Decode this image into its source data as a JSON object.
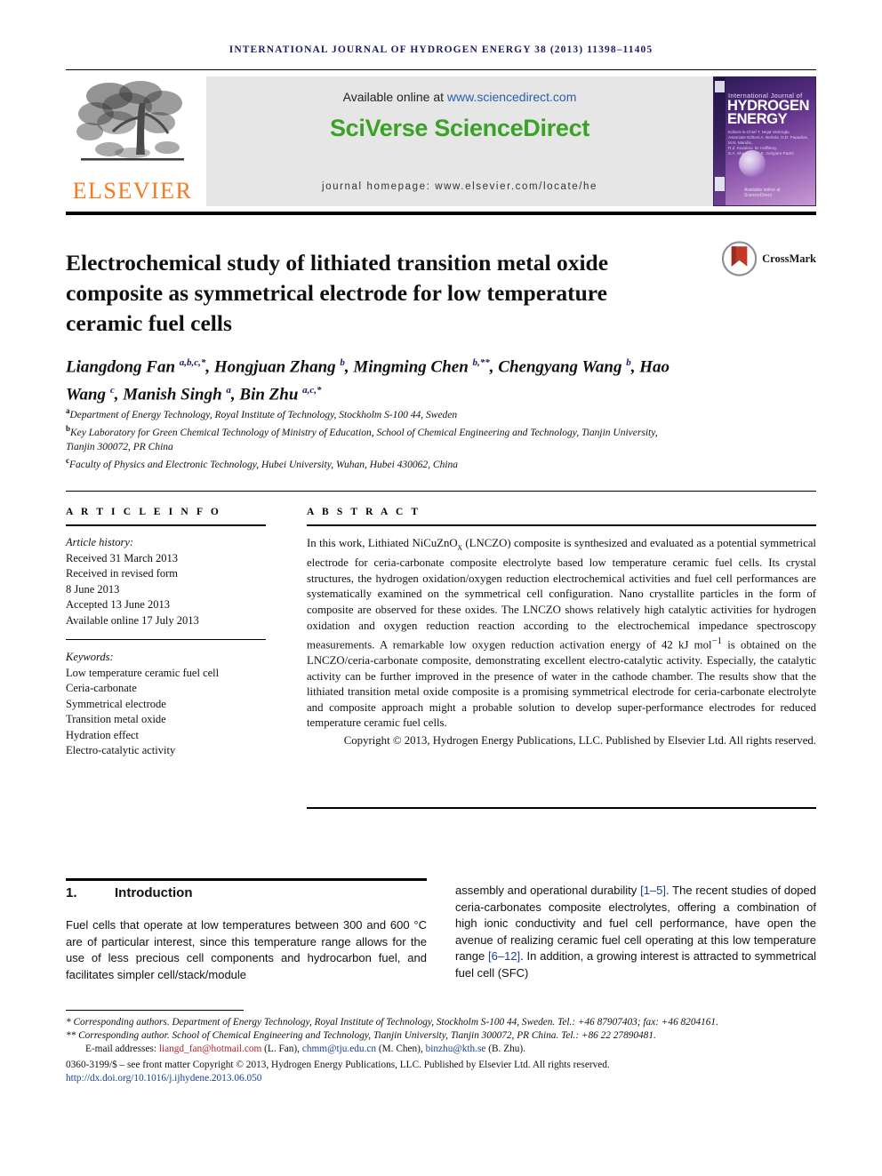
{
  "running_head": "INTERNATIONAL JOURNAL OF HYDROGEN ENERGY 38 (2013) 11398–11405",
  "masthead": {
    "publisher": "ELSEVIER",
    "available_prefix": "Available online at ",
    "available_link": "www.sciencedirect.com",
    "sciencedirect_logo": "SciVerse ScienceDirect",
    "journal_homepage": "journal homepage: www.elsevier.com/locate/he",
    "cover": {
      "line1": "International Journal of",
      "line2": "HYDROGEN",
      "line3": "ENERGY",
      "editors": "Editors-in-Chief  T. Nejat Veziroglu\nAssociate Editors  A. Bertola, D.D. Papadias, M.N. Mandis,\nR.Z. Kazakov, M. Hoffberg,\nS.A. Sherif and C.E. Grégoire Padró",
      "footer": "Available online at\nScienceDirect"
    }
  },
  "article": {
    "title": "Electrochemical study of lithiated transition metal oxide composite as symmetrical electrode for low temperature ceramic fuel cells",
    "crossmark_label": "CrossMark",
    "authors_html": "Liangdong Fan <sup>a,b,c,*</sup>, Hongjuan Zhang <sup>b</sup>, Mingming Chen <sup>b,**</sup>, Chengyang Wang <sup>b</sup>, Hao Wang <sup>c</sup>, Manish Singh <sup>a</sup>, Bin Zhu <sup>a,c,*</sup>",
    "affiliations": [
      {
        "mark": "a",
        "text": "Department of Energy Technology, Royal Institute of Technology, Stockholm S-100 44, Sweden"
      },
      {
        "mark": "b",
        "text": "Key Laboratory for Green Chemical Technology of Ministry of Education, School of Chemical Engineering and Technology, Tianjin University, Tianjin 300072, PR China"
      },
      {
        "mark": "c",
        "text": "Faculty of Physics and Electronic Technology, Hubei University, Wuhan, Hubei 430062, China"
      }
    ]
  },
  "article_info": {
    "heading": "A R T I C L E   I N F O",
    "history_label": "Article history:",
    "history": [
      "Received 31 March 2013",
      "Received in revised form",
      "8 June 2013",
      "Accepted 13 June 2013",
      "Available online 17 July 2013"
    ],
    "keywords_label": "Keywords:",
    "keywords": [
      "Low temperature ceramic fuel cell",
      "Ceria-carbonate",
      "Symmetrical electrode",
      "Transition metal oxide",
      "Hydration effect",
      "Electro-catalytic activity"
    ]
  },
  "abstract": {
    "heading": "A B S T R A C T",
    "body_html": "In this work, Lithiated NiCuZnO<sub>x</sub> (LNCZO) composite is synthesized and evaluated as a potential symmetrical electrode for ceria-carbonate composite electrolyte based low temperature ceramic fuel cells. Its crystal structures, the hydrogen oxidation/oxygen reduction electrochemical activities and fuel cell performances are systematically examined on the symmetrical cell configuration. Nano crystallite particles in the form of composite are observed for these oxides. The LNCZO shows relatively high catalytic activities for hydrogen oxidation and oxygen reduction reaction according to the electrochemical impedance spectroscopy measurements. A remarkable low oxygen reduction activation energy of 42 kJ mol<sup>−1</sup> is obtained on the LNCZO/ceria-carbonate composite, demonstrating excellent electro-catalytic activity. Especially, the catalytic activity can be further improved in the presence of water in the cathode chamber. The results show that the lithiated transition metal oxide composite is a promising symmetrical electrode for ceria-carbonate electrolyte and composite approach might a probable solution to develop super-performance electrodes for reduced temperature ceramic fuel cells.",
    "copyright": "Copyright © 2013, Hydrogen Energy Publications, LLC. Published by Elsevier Ltd. All rights reserved."
  },
  "body": {
    "section_number": "1.",
    "section_title": "Introduction",
    "left_column_html": "Fuel cells that operate at low temperatures between 300 and 600 °C are of particular interest, since this temperature range allows for the use of less precious cell components and hydrocarbon fuel, and facilitates simpler cell/stack/module",
    "right_column_html": "assembly and operational durability <span class=\"ref\">[1–5]</span>. The recent studies of doped ceria-carbonates composite electrolytes, offering a combination of high ionic conductivity and fuel cell performance, have open the avenue of realizing ceramic fuel cell operating at this low temperature range <span class=\"ref\">[6–12]</span>. In addition, a growing interest is attracted to symmetrical fuel cell (SFC)"
  },
  "footnotes": {
    "corresponding_1_html": "<span class=\"ital\">* Corresponding authors. Department of Energy Technology, Royal Institute of Technology, Stockholm S-100 44, Sweden. Tel.: +46 87907403; fax: +46 8204161.</span>",
    "corresponding_2_html": "<span class=\"ital\">** Corresponding author. School of Chemical Engineering and Technology, Tianjin University, Tianjin 300072, PR China. Tel.: +86 22 27890481.</span>",
    "emails_html": "E-mail addresses: <span class=\"mail\">liangd_fan@hotmail.com</span> (L. Fan), <span class=\"mail2\">chmm@tju.edu.cn</span> (M. Chen), <span class=\"mail2\">binzhu@kth.se</span> (B. Zhu).",
    "issn_line": "0360-3199/$ – see front matter Copyright © 2013, Hydrogen Energy Publications, LLC. Published by Elsevier Ltd. All rights reserved.",
    "doi": "http://dx.doi.org/10.1016/j.ijhydene.2013.06.050"
  },
  "colors": {
    "running_head": "#1b1b63",
    "elsevier_orange": "#F47920",
    "sciencedirect_green": "#3aa327",
    "link_blue": "#1b3f94",
    "email_red": "#b1272d"
  }
}
